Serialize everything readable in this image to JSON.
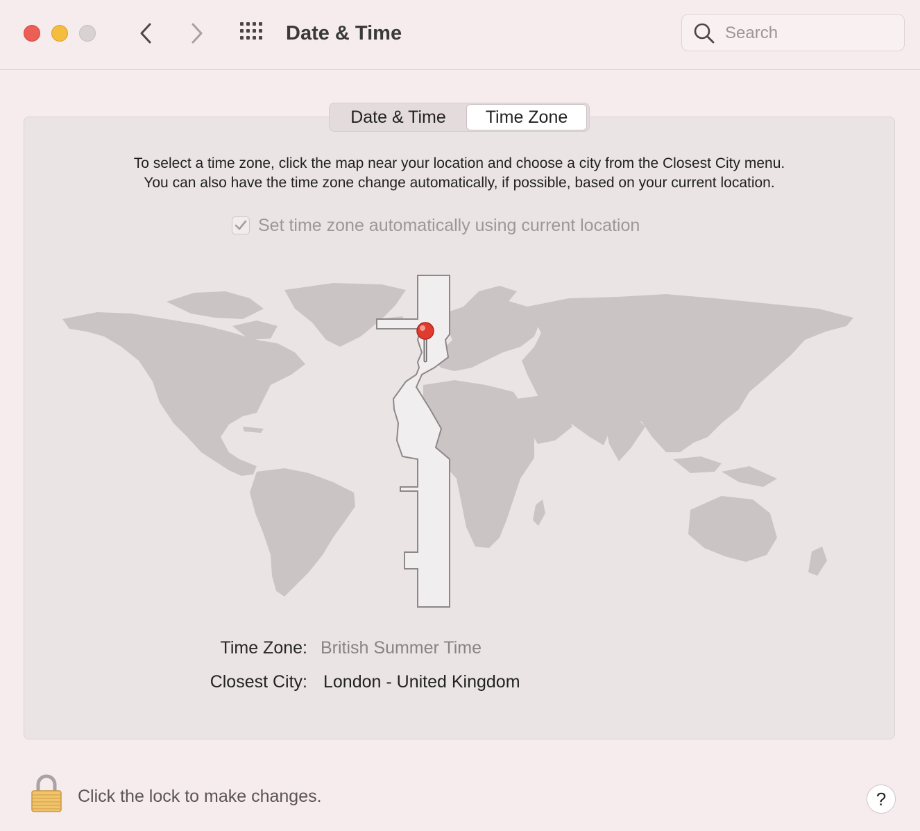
{
  "window": {
    "title": "Date & Time",
    "controls": [
      "close",
      "minimize",
      "zoom"
    ]
  },
  "toolbar": {
    "back_icon": "chevron-left-icon",
    "forward_icon": "chevron-right-icon",
    "grid_icon": "grid-icon",
    "search_placeholder": "Search",
    "search_value": ""
  },
  "tabs": [
    {
      "label": "Date & Time",
      "selected": false
    },
    {
      "label": "Time Zone",
      "selected": true
    }
  ],
  "timezone_pane": {
    "instructions_line1": "To select a time zone, click the map near your location and choose a city from the Closest City menu.",
    "instructions_line2": "You can also have the time zone change automatically, if possible, based on your current location.",
    "auto_checkbox_label": "Set time zone automatically using current location",
    "auto_checked": true,
    "time_zone_label": "Time Zone:",
    "time_zone_value": "British Summer Time",
    "closest_city_label": "Closest City:",
    "closest_city_value": "London - United Kingdom"
  },
  "footer": {
    "lock_text": "Click the lock to make changes.",
    "help_label": "?"
  },
  "colors": {
    "background": "#f6ecee",
    "panel": "#ebe4e5",
    "land": "#cbc4c5",
    "selected_zone": "#f1eeef",
    "pin_red": "#e03b2f"
  }
}
